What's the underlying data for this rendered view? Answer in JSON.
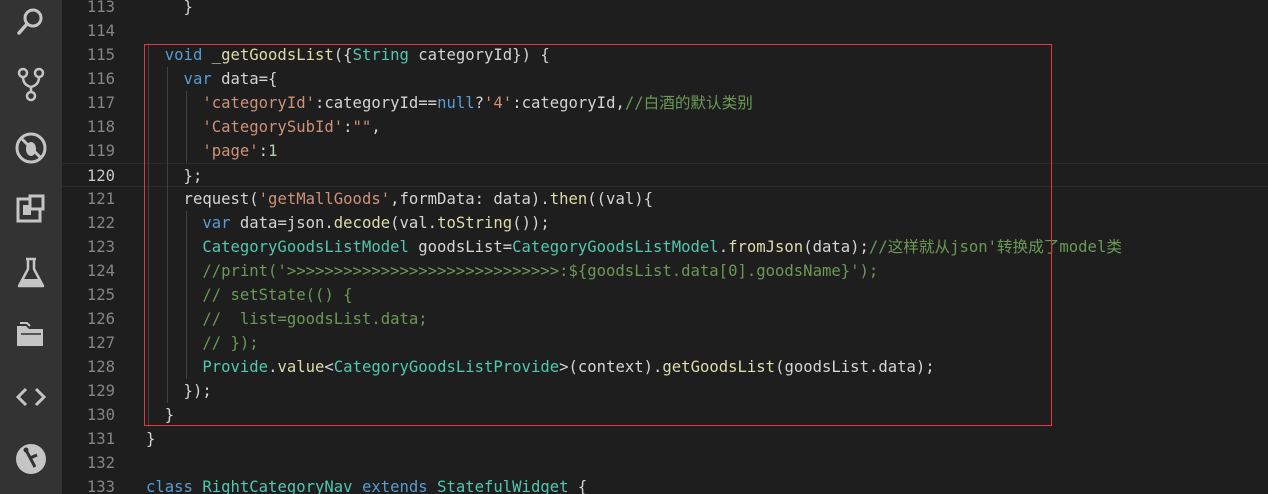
{
  "activity_bar": {
    "icons": [
      "search-icon",
      "source-control-icon",
      "debug-icon",
      "extensions-icon",
      "flask-icon",
      "folder-icon",
      "code-brackets-icon",
      "git-graph-icon"
    ]
  },
  "colors": {
    "keyword": "#569cd6",
    "type": "#4ec9b0",
    "function": "#dcdcaa",
    "string": "#ce9178",
    "number": "#b5cea8",
    "comment": "#6a9955",
    "plain": "#d4d4d4",
    "highlight_box": "#e0383e"
  },
  "editor": {
    "active_line": "120",
    "lines": [
      {
        "num": "113",
        "tokens": [
          {
            "t": "    }",
            "c": "pl"
          }
        ]
      },
      {
        "num": "114",
        "tokens": []
      },
      {
        "num": "115",
        "tokens": [
          {
            "t": "  void ",
            "c": "kw"
          },
          {
            "t": "_getGoodsList",
            "c": "fn"
          },
          {
            "t": "({",
            "c": "pl"
          },
          {
            "t": "String",
            "c": "ty"
          },
          {
            "t": " categoryId}) {",
            "c": "pl"
          }
        ]
      },
      {
        "num": "116",
        "tokens": [
          {
            "t": "    var ",
            "c": "kw"
          },
          {
            "t": "data={",
            "c": "pl"
          }
        ]
      },
      {
        "num": "117",
        "tokens": [
          {
            "t": "      'categoryId'",
            "c": "str"
          },
          {
            "t": ":categoryId==",
            "c": "pl"
          },
          {
            "t": "null",
            "c": "kw"
          },
          {
            "t": "?",
            "c": "pl"
          },
          {
            "t": "'4'",
            "c": "str"
          },
          {
            "t": ":categoryId,",
            "c": "pl"
          },
          {
            "t": "//白酒的默认类别",
            "c": "cm"
          }
        ]
      },
      {
        "num": "118",
        "tokens": [
          {
            "t": "      'CategorySubId'",
            "c": "str"
          },
          {
            "t": ":",
            "c": "pl"
          },
          {
            "t": "\"\"",
            "c": "str"
          },
          {
            "t": ",",
            "c": "pl"
          }
        ]
      },
      {
        "num": "119",
        "tokens": [
          {
            "t": "      'page'",
            "c": "str"
          },
          {
            "t": ":",
            "c": "pl"
          },
          {
            "t": "1",
            "c": "num"
          }
        ]
      },
      {
        "num": "120",
        "tokens": [
          {
            "t": "    };",
            "c": "pl"
          }
        ]
      },
      {
        "num": "121",
        "tokens": [
          {
            "t": "    request(",
            "c": "pl"
          },
          {
            "t": "'getMallGoods'",
            "c": "str"
          },
          {
            "t": ",formData: data).",
            "c": "pl"
          },
          {
            "t": "then",
            "c": "fn"
          },
          {
            "t": "((val){",
            "c": "pl"
          }
        ]
      },
      {
        "num": "122",
        "tokens": [
          {
            "t": "      var ",
            "c": "kw"
          },
          {
            "t": "data=json.",
            "c": "pl"
          },
          {
            "t": "decode",
            "c": "fn"
          },
          {
            "t": "(val.",
            "c": "pl"
          },
          {
            "t": "toString",
            "c": "fn"
          },
          {
            "t": "());",
            "c": "pl"
          }
        ]
      },
      {
        "num": "123",
        "tokens": [
          {
            "t": "      CategoryGoodsListModel",
            "c": "ty"
          },
          {
            "t": " goodsList=",
            "c": "pl"
          },
          {
            "t": "CategoryGoodsListModel",
            "c": "ty"
          },
          {
            "t": ".",
            "c": "pl"
          },
          {
            "t": "fromJson",
            "c": "fn"
          },
          {
            "t": "(data);",
            "c": "pl"
          },
          {
            "t": "//这样就从json'转换成了model类",
            "c": "cm"
          }
        ]
      },
      {
        "num": "124",
        "tokens": [
          {
            "t": "      //print('>>>>>>>>>>>>>>>>>>>>>>>>>>>>>:${goodsList.data[0].goodsName}');",
            "c": "cm"
          }
        ]
      },
      {
        "num": "125",
        "tokens": [
          {
            "t": "      // setState(() {",
            "c": "cm"
          }
        ]
      },
      {
        "num": "126",
        "tokens": [
          {
            "t": "      //  list=goodsList.data;",
            "c": "cm"
          }
        ]
      },
      {
        "num": "127",
        "tokens": [
          {
            "t": "      // });",
            "c": "cm"
          }
        ]
      },
      {
        "num": "128",
        "tokens": [
          {
            "t": "      Provide",
            "c": "ty"
          },
          {
            "t": ".",
            "c": "pl"
          },
          {
            "t": "value",
            "c": "fn"
          },
          {
            "t": "<",
            "c": "pl"
          },
          {
            "t": "CategoryGoodsListProvide",
            "c": "ty"
          },
          {
            "t": ">(context).",
            "c": "pl"
          },
          {
            "t": "getGoodsList",
            "c": "fn"
          },
          {
            "t": "(goodsList.data);",
            "c": "pl"
          }
        ]
      },
      {
        "num": "129",
        "tokens": [
          {
            "t": "    });",
            "c": "pl"
          }
        ]
      },
      {
        "num": "130",
        "tokens": [
          {
            "t": "  }",
            "c": "pl"
          }
        ]
      },
      {
        "num": "131",
        "tokens": [
          {
            "t": "}",
            "c": "pl"
          }
        ]
      },
      {
        "num": "132",
        "tokens": []
      },
      {
        "num": "133",
        "tokens": [
          {
            "t": "class ",
            "c": "kw"
          },
          {
            "t": "RightCategoryNav",
            "c": "ty"
          },
          {
            "t": " extends ",
            "c": "kw"
          },
          {
            "t": "StatefulWidget",
            "c": "ty"
          },
          {
            "t": " {",
            "c": "pl"
          }
        ]
      }
    ]
  }
}
